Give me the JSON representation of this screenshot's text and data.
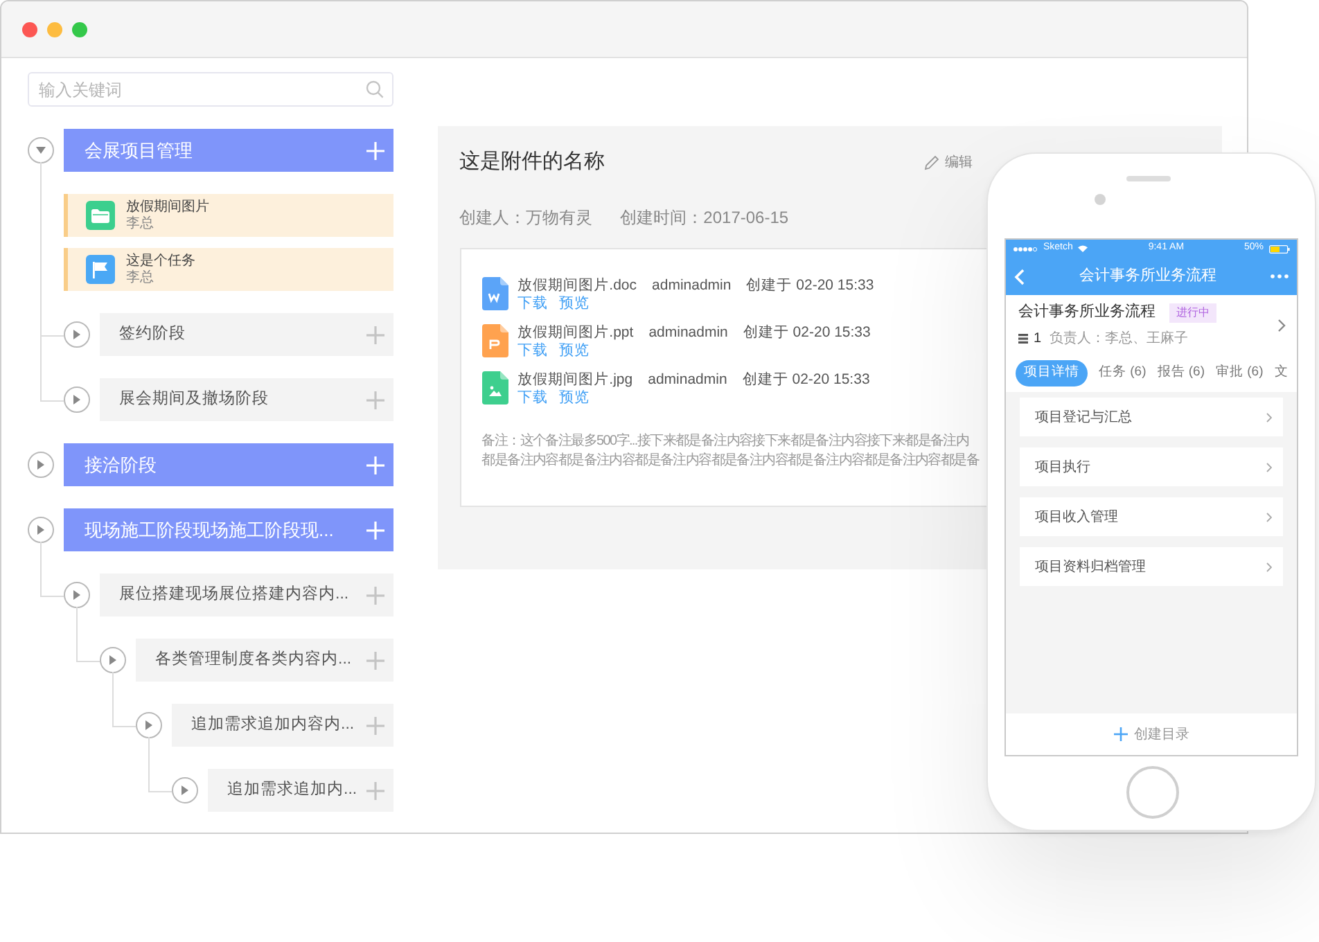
{
  "window": {
    "controls": [
      {
        "color": "#fc5753"
      },
      {
        "color": "#fdbc40"
      },
      {
        "color": "#34c84a"
      }
    ]
  },
  "search": {
    "placeholder": "输入关键词"
  },
  "tree": [
    {
      "kind": "phase",
      "label": "会展项目管理",
      "expanded": true,
      "children": [
        {
          "kind": "folder",
          "title": "放假期间图片",
          "owner": "李总"
        },
        {
          "kind": "task",
          "title": "这是个任务",
          "owner": "李总"
        },
        {
          "kind": "stage",
          "label": "签约阶段",
          "expanded": false
        },
        {
          "kind": "stage",
          "label": "展会期间及撤场阶段",
          "expanded": false
        }
      ]
    },
    {
      "kind": "phase",
      "label": "接洽阶段",
      "expanded": false
    },
    {
      "kind": "phase",
      "label": "现场施工阶段现场施工阶段现...",
      "expanded": false,
      "children": [
        {
          "kind": "stage",
          "label": "展位搭建现场展位搭建内容内...",
          "expanded": false,
          "children": [
            {
              "kind": "stage",
              "label": "各类管理制度各类内容内...",
              "expanded": false,
              "children": [
                {
                  "kind": "stage",
                  "label": "追加需求追加内容内...",
                  "expanded": false,
                  "children": [
                    {
                      "kind": "stage",
                      "label": "追加需求追加内...",
                      "expanded": false
                    }
                  ]
                }
              ]
            }
          ]
        }
      ]
    }
  ],
  "detail": {
    "title": "这是附件的名称",
    "actions": [
      {
        "label": "编辑"
      }
    ],
    "creator": "创建人：万物有灵",
    "created": "创建时间：2017-06-15",
    "attachments": [
      {
        "kind": "doc",
        "name": "放假期间图片.doc",
        "user": "adminadmin",
        "time": "创建于 02-20 15:33",
        "links": [
          "下载",
          "预览"
        ]
      },
      {
        "kind": "ppt",
        "name": "放假期间图片.ppt",
        "user": "adminadmin",
        "time": "创建于 02-20 15:33",
        "links": [
          "下载",
          "预览"
        ]
      },
      {
        "kind": "image",
        "name": "放假期间图片.jpg",
        "user": "adminadmin",
        "time": "创建于 02-20 15:33",
        "links": [
          "下载",
          "预览"
        ]
      }
    ],
    "note_lines": [
      "备注：这个备注最多500字...接下来都是备注内容接下来都是备注内容接下来都是备注内",
      "都是备注内容都是备注内容都是备注内容都是备注内容都是备注内容都是备注内容都是备"
    ]
  },
  "phone": {
    "status": {
      "carrier": "Sketch",
      "time": "9:41 AM",
      "battery": "50%"
    },
    "nav_title": "会计事务所业务流程",
    "header": {
      "title": "会计事务所业务流程",
      "badge": "进行中",
      "count": "1",
      "owner": "负责人：李总、王麻子"
    },
    "tabs": [
      {
        "label": "项目详情",
        "selected": true
      },
      {
        "label": "任务 (6)",
        "selected": false
      },
      {
        "label": "报告 (6)",
        "selected": false
      },
      {
        "label": "审批 (6)",
        "selected": false
      },
      {
        "label": "文",
        "selected": false
      }
    ],
    "items": [
      "项目登记与汇总",
      "项目执行",
      "项目收入管理",
      "项目资料归档管理"
    ],
    "footer": "创建目录"
  }
}
